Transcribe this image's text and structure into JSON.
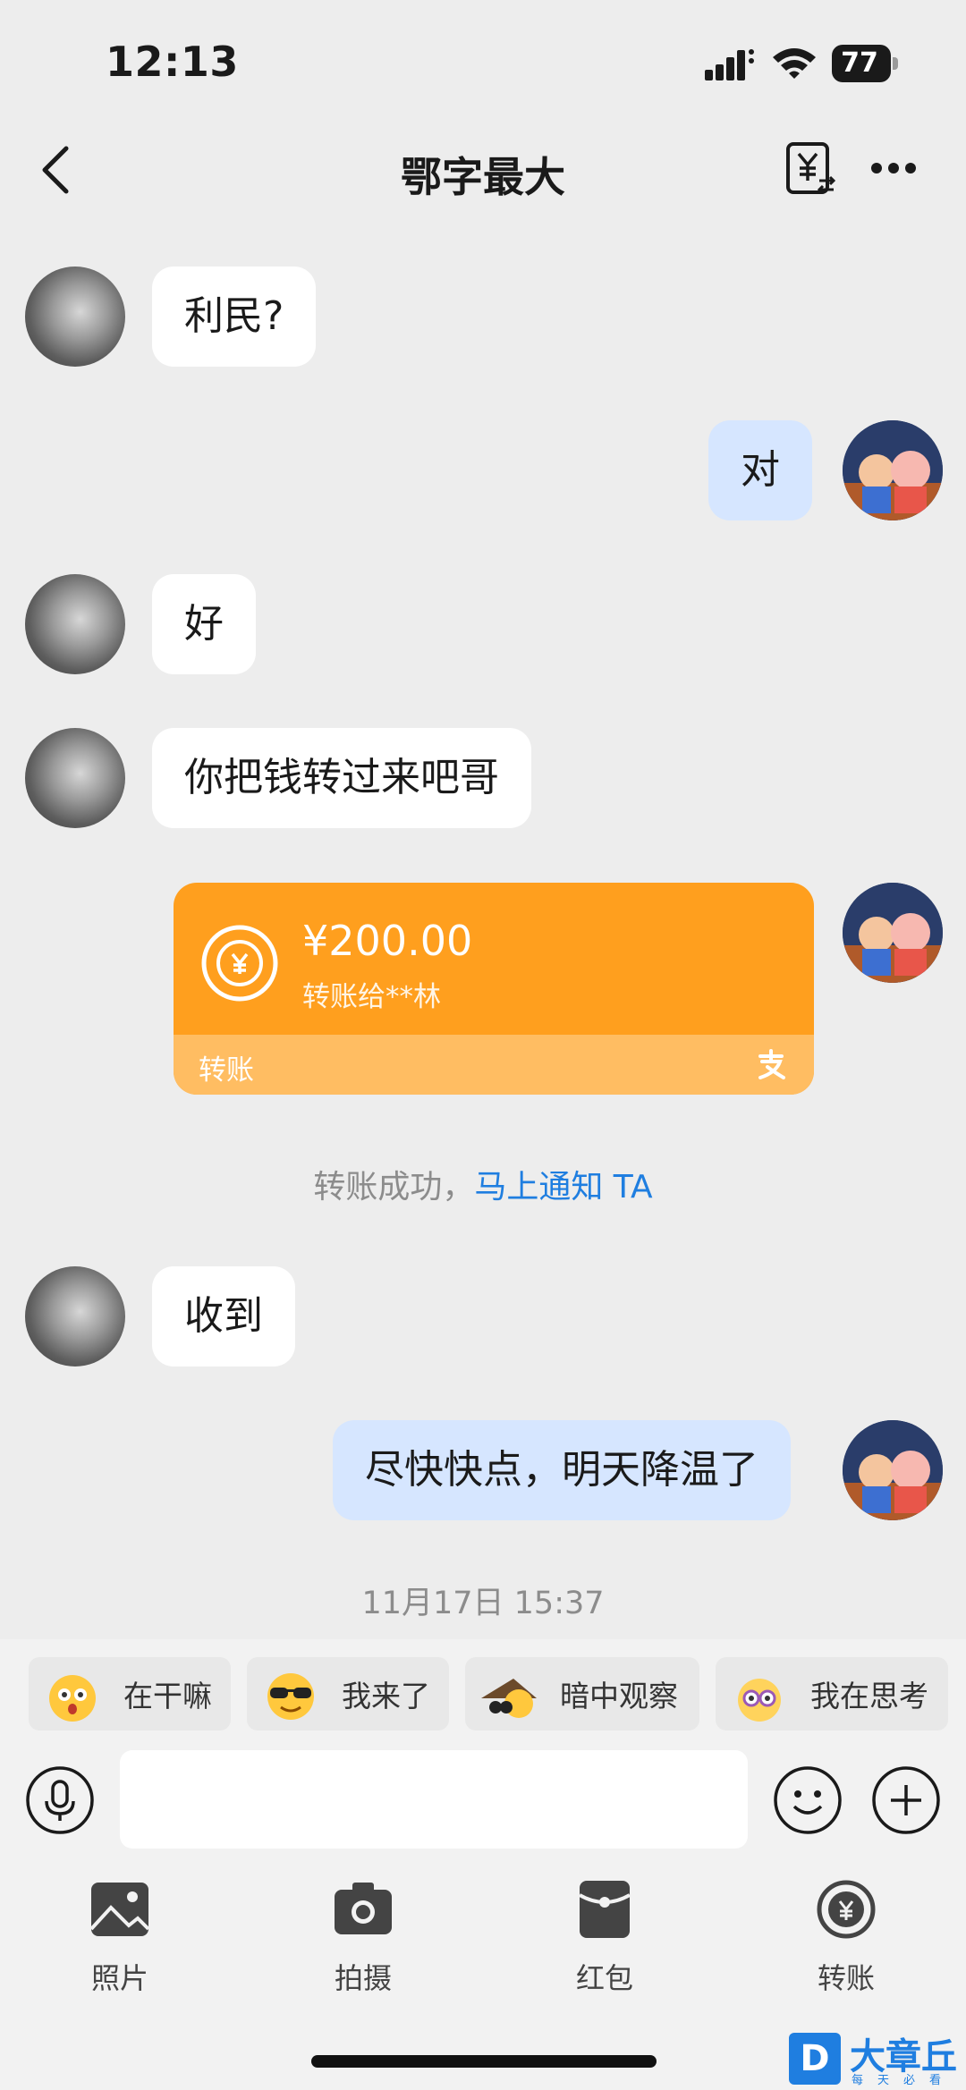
{
  "status_bar": {
    "time": "12:13",
    "battery": "77"
  },
  "header": {
    "title": "鄂字最大"
  },
  "messages": [
    {
      "side": "left",
      "text": "利民?"
    },
    {
      "side": "right",
      "text": "对"
    },
    {
      "side": "left",
      "text": "好"
    },
    {
      "side": "left",
      "text": "你把钱转过来吧哥"
    },
    {
      "side": "left",
      "text": "收到"
    },
    {
      "side": "right",
      "text": "尽快快点，明天降温了"
    }
  ],
  "transfer": {
    "amount": "¥200.00",
    "to": "转账给**林",
    "label": "转账"
  },
  "system_note": {
    "text": "转账成功，",
    "link": "马上通知 TA"
  },
  "timestamp": "11月17日 15:37",
  "quick_replies": [
    "在干嘛",
    "我来了",
    "暗中观察",
    "我在思考"
  ],
  "toolbar": [
    "照片",
    "拍摄",
    "红包",
    "转账"
  ],
  "watermark": {
    "name": "大章丘",
    "sub": "每天必看"
  },
  "colors": {
    "transfer_orange": "#ff9f1e",
    "self_bubble": "#d6e6ff",
    "link_blue": "#1f7ee0",
    "background": "#ededed"
  }
}
